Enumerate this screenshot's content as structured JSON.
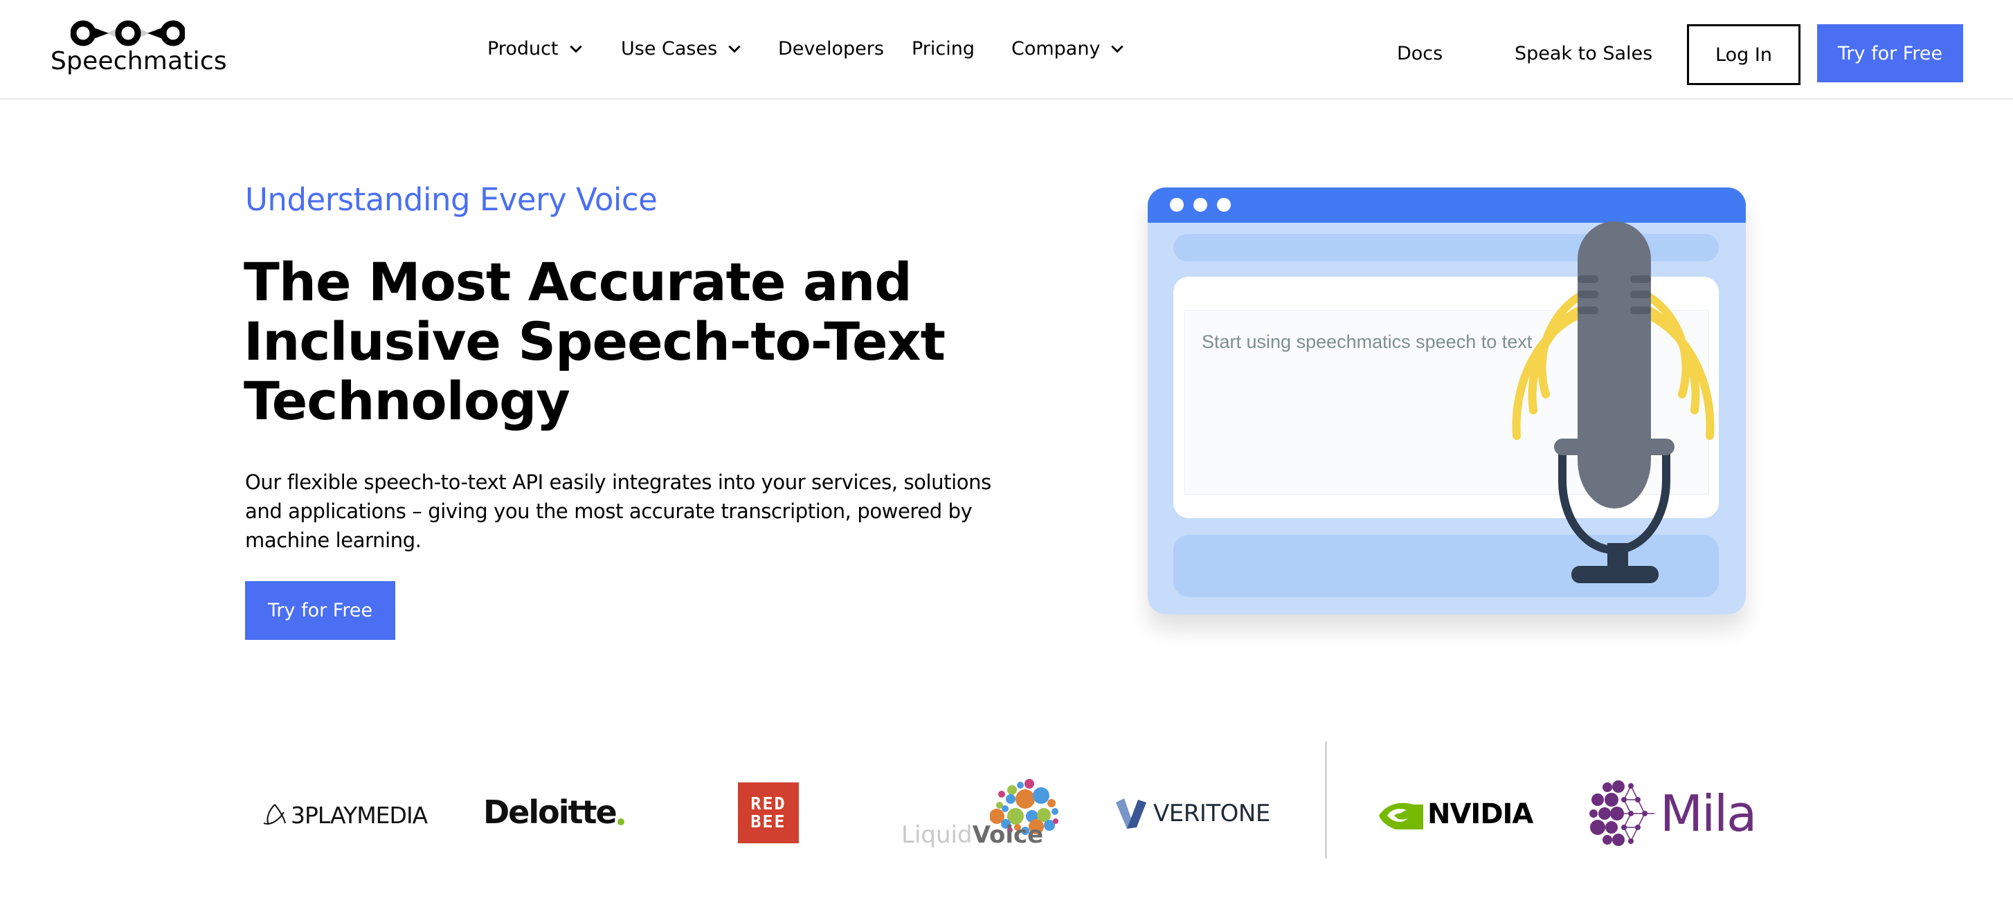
{
  "header": {
    "brand": "Speechmatics",
    "nav": [
      {
        "label": "Product",
        "has_dropdown": true
      },
      {
        "label": "Use Cases",
        "has_dropdown": true
      },
      {
        "label": "Developers",
        "has_dropdown": false
      },
      {
        "label": "Pricing",
        "has_dropdown": false
      },
      {
        "label": "Company",
        "has_dropdown": true
      }
    ],
    "docs_label": "Docs",
    "sales_label": "Speak to Sales",
    "login_label": "Log In",
    "try_label": "Try for Free"
  },
  "hero": {
    "eyebrow": "Understanding Every Voice",
    "headline_lines": [
      "The Most Accurate and",
      "Inclusive Speech-to-Text",
      "Technology"
    ],
    "subcopy": "Our flexible speech-to-text API easily integrates into your services, solutions and applications – giving you the most accurate transcription, powered by machine learning.",
    "cta_label": "Try for Free"
  },
  "illustration": {
    "textarea_text": "Start using speechmatics speech to text",
    "icons": [
      "browser-window-icon",
      "microphone-icon",
      "sound-waves-icon"
    ]
  },
  "logos": [
    {
      "name": "3PLAYMEDIA"
    },
    {
      "name": "Deloitte"
    },
    {
      "name": "RED BEE"
    },
    {
      "name": "LiquidVoice",
      "parts": [
        "Liquid",
        "Voice"
      ]
    },
    {
      "name": "VERITONE"
    },
    {
      "name": "NVIDIA"
    },
    {
      "name": "Mila"
    }
  ],
  "colors": {
    "accent": "#4a6ff2",
    "window_bar": "#427af3",
    "window_bg": "#c6dcfa",
    "mic_body": "#6b7280",
    "mic_stand": "#2c3a4e",
    "sound_waves": "#f5d34a"
  }
}
